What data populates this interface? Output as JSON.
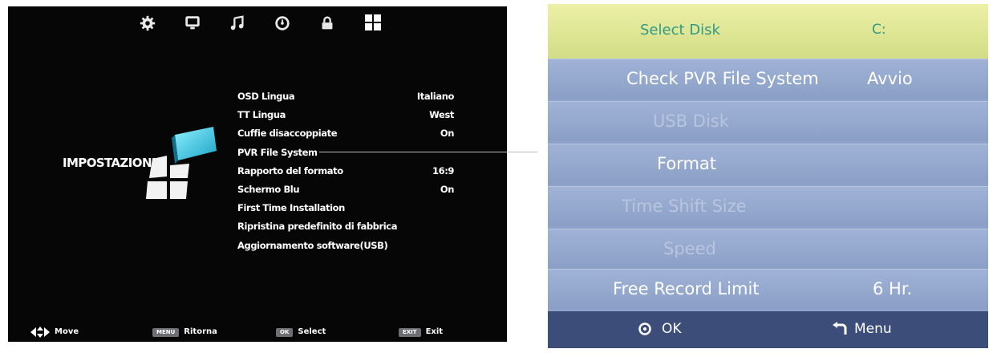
{
  "tv_menu": {
    "top_icons": [
      "settings-gear-icon",
      "monitor-icon",
      "music-note-icon",
      "clock-icon",
      "lock-icon",
      "grid-icon"
    ],
    "section_title": "IMPOSTAZIONI",
    "items": [
      {
        "label": "OSD Lingua",
        "value": "Italiano"
      },
      {
        "label": "TT Lingua",
        "value": "West"
      },
      {
        "label": "Cuffie disaccoppiate",
        "value": "On"
      },
      {
        "label": "PVR File System",
        "value": ""
      },
      {
        "label": "Rapporto del formato",
        "value": "16:9"
      },
      {
        "label": "Schermo Blu",
        "value": "On"
      },
      {
        "label": "First Time Installation",
        "value": ""
      },
      {
        "label": "Ripristina predefinito di fabbrica",
        "value": ""
      },
      {
        "label": "Aggiornamento software(USB)",
        "value": ""
      }
    ],
    "footer": {
      "move_label": "Move",
      "return_key": "MENU",
      "return_label": "Ritorna",
      "select_key": "OK",
      "select_label": "Select",
      "exit_key": "EXIT",
      "exit_label": "Exit"
    }
  },
  "pvr_menu": {
    "header": {
      "label": "Select Disk",
      "value": "C:"
    },
    "rows": [
      {
        "label": "Check PVR File System",
        "value": "Avvio",
        "enabled": true
      },
      {
        "label": "USB Disk",
        "value": "",
        "enabled": false
      },
      {
        "label": "Format",
        "value": "",
        "enabled": true
      },
      {
        "label": "Time Shift Size",
        "value": "",
        "enabled": false
      },
      {
        "label": "Speed",
        "value": "",
        "enabled": false
      },
      {
        "label": "Free Record Limit",
        "value": "6 Hr.",
        "enabled": true
      }
    ],
    "footer": {
      "ok_label": "OK",
      "menu_label": "Menu"
    }
  },
  "colors": {
    "tv_background": "#060606",
    "pvr_background": "#8fa3ca",
    "pvr_header": "#dfe694",
    "pvr_header_text": "#2f9a86",
    "pvr_footer": "#3d4d7a",
    "dim_text": "#b9c5de"
  }
}
